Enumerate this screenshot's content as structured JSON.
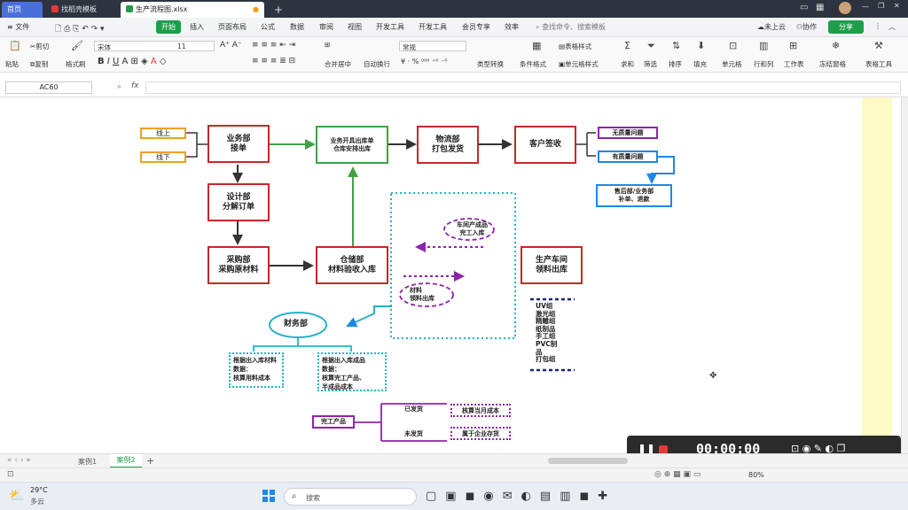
{
  "titlebar": {
    "home": "首页",
    "tab1": "找稻壳模板",
    "tab2": "生产流程图.xlsx",
    "plus": "+"
  },
  "menu": {
    "file": "文件",
    "start": "开始",
    "insert": "插入",
    "layout": "页面布局",
    "formula": "公式",
    "data": "数据",
    "review": "审阅",
    "view": "视图",
    "dev_tools": "开发工具",
    "dev_tools2": "开发工具",
    "member": "会员专享",
    "efficiency": "效率",
    "search_placeholder": "查找命令、搜索模板",
    "cloud": "未上云",
    "collab": "协作",
    "share": "分享"
  },
  "ribbon": {
    "cut": "剪切",
    "paste": "粘贴",
    "copy": "复制",
    "format_painter": "格式刷",
    "font": "宋体",
    "size": "11",
    "merge": "合并居中",
    "wrap": "自动换行",
    "number_format": "常规",
    "type_convert": "类型转换",
    "cond_format": "条件格式",
    "table_style": "表格样式",
    "cell_style": "单元格样式",
    "sum": "求和",
    "filter": "筛选",
    "sort": "排序",
    "fill": "填充",
    "cell": "单元格",
    "rowcol": "行和列",
    "sheet": "工作表",
    "freeze": "冻结窗格",
    "tools": "表格工具"
  },
  "formula": {
    "cell_ref": "AC60",
    "fx": "fx"
  },
  "chart": {
    "online": "线上",
    "offline": "线下",
    "sales": "业务部\n接单",
    "issue": "业务开具出库单\n仓库安排出库",
    "logistics": "物流部\n打包发货",
    "customer": "客户签收",
    "noquality": "无质量问题",
    "quality": "有质量问题",
    "aftersales": "售后部/业务部\n补单、退款",
    "design": "设计部\n分解订单",
    "purchase": "采购部\n采购原材料",
    "warehouse": "仓储部\n材料验收入库",
    "workshop_in": "车间产成品\n完工入库",
    "material_out": "材料\n领料出库",
    "production": "生产车间\n领料出库",
    "groups": "UV组\n激光组\n精雕组\n纸制品\n手工组\nPVC制\n品\n打包组",
    "finance": "财务部",
    "calc_material": "根据出入库材料\n数据：\n核算用料成本",
    "calc_product": "根据出入库成品\n数据：\n核算完工产品、\n半成品成本",
    "finished": "完工产品",
    "shipped": "已发货",
    "notshipped": "未发货",
    "cost_month": "核算当月成本",
    "inventory": "属于企业存货"
  },
  "sheets": {
    "tab1": "案例1",
    "tab2": "案例2",
    "add": "+"
  },
  "status": {
    "zoom": "80%"
  },
  "recorder": {
    "time": "00:00:00"
  },
  "taskbar": {
    "temp": "29°C",
    "weather": "多云",
    "search": "搜索"
  }
}
